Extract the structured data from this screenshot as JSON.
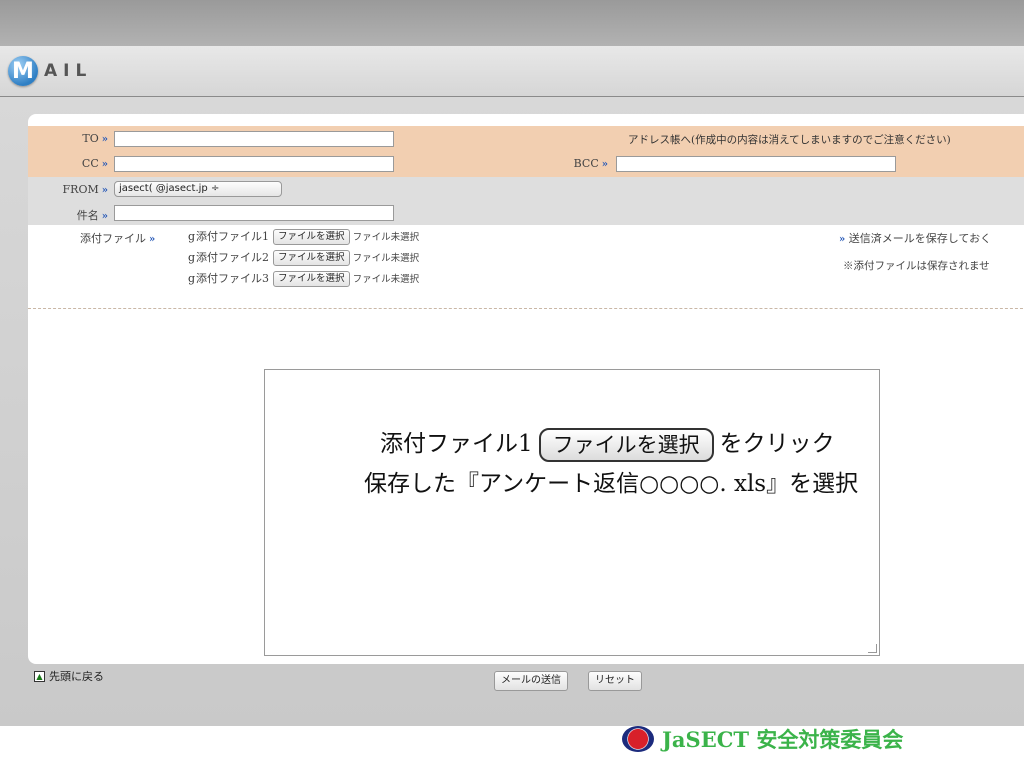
{
  "header": {
    "logo_letter": "M",
    "logo_text": "AIL"
  },
  "form": {
    "to": {
      "label": "TO",
      "value": ""
    },
    "address_book_note": "アドレス帳へ(作成中の内容は消えてしまいますのでご注意ください)",
    "cc": {
      "label": "CC",
      "value": ""
    },
    "bcc": {
      "label": "BCC",
      "value": ""
    },
    "from": {
      "label": "FROM",
      "selected": "jasect(         @jasect.jp  ÷"
    },
    "subject": {
      "label": "件名",
      "value": ""
    },
    "attach_label": "添付ファイル",
    "attachments": [
      {
        "label": "添付ファイル1",
        "button": "ファイルを選択",
        "status": "ファイル未選択"
      },
      {
        "label": "添付ファイル2",
        "button": "ファイルを選択",
        "status": "ファイル未選択"
      },
      {
        "label": "添付ファイル3",
        "button": "ファイルを選択",
        "status": "ファイル未選択"
      }
    ],
    "save_sent_note": "送信済メールを保存しておく",
    "attach_not_saved_note": "※添付ファイルは保存されませ",
    "send_button": "メールの送信",
    "reset_button": "リセット"
  },
  "instruction": {
    "line1_prefix": "添付ファイル1",
    "line1_button": "ファイルを選択",
    "line1_suffix": "をクリック",
    "line2": "保存した『アンケート返信○○○○. xls』を選択"
  },
  "back_to_top": "先頭に戻る",
  "footer": {
    "org": "JaSECT 安全対策委員会"
  },
  "colors": {
    "orange_row": "#f2cfb1",
    "footer_green": "#3bb34a",
    "arrow_blue": "#2a5bb8"
  }
}
